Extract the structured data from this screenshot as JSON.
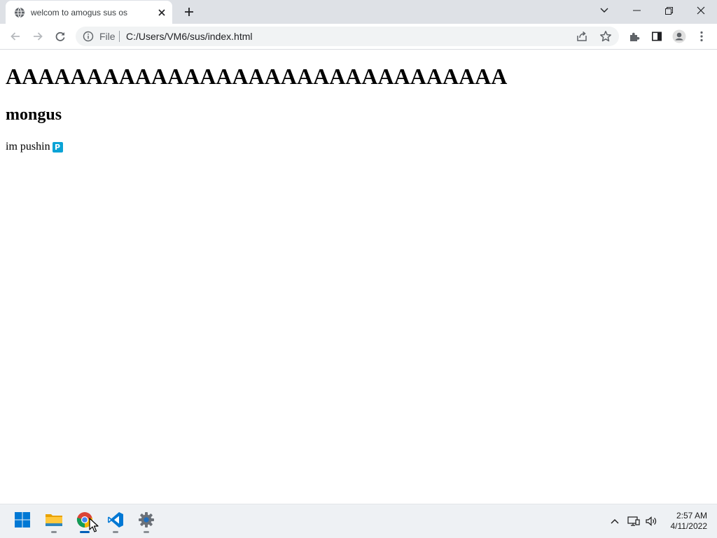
{
  "browser": {
    "tab": {
      "title": "welcom to amogus sus os",
      "favicon": "globe-icon"
    },
    "omnibox": {
      "scheme_label": "File",
      "url": "C:/Users/VM6/sus/index.html"
    }
  },
  "page": {
    "heading1": "AAAAAAAAAAAAAAAAAAAAAAAAAAAAAAA",
    "heading2": "mongus",
    "paragraph": "im pushin",
    "badge": "P",
    "badge_color": "#0aa3d6"
  },
  "taskbar": {
    "apps": [
      "start-icon",
      "file-explorer-icon",
      "chrome-icon",
      "vscode-icon",
      "settings-icon"
    ],
    "clock_time": "2:57 AM",
    "clock_date": "4/11/2022"
  }
}
